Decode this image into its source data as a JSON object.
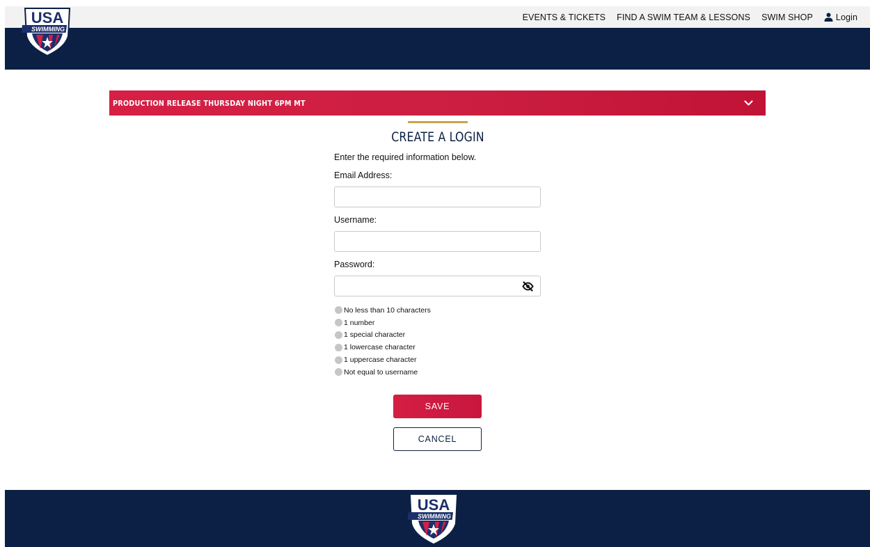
{
  "header": {
    "nav": [
      "EVENTS & TICKETS",
      "FIND A SWIM TEAM & LESSONS",
      "SWIM SHOP"
    ],
    "login_label": "Login",
    "logo": {
      "top": "USA",
      "bottom": "SWIMMING"
    }
  },
  "alert": {
    "text": "PRODUCTION RELEASE THURSDAY NIGHT 6PM MT"
  },
  "form": {
    "title": "CREATE A LOGIN",
    "subtitle": "Enter the required information below.",
    "email_label": "Email Address:",
    "email_value": "",
    "username_label": "Username:",
    "username_value": "",
    "password_label": "Password:",
    "password_value": "",
    "rules": [
      "No less than 10 characters",
      "1 number",
      "1 special character",
      "1 lowercase character",
      "1 uppercase character",
      "Not equal to username"
    ],
    "save_label": "SAVE",
    "cancel_label": "CANCEL"
  },
  "colors": {
    "navy": "#0b2044",
    "red": "#d61f44",
    "gold": "#c7a44b",
    "rule_dot": "#c6c6c6"
  },
  "icons": {
    "user": "user-icon",
    "chevron": "chevron-down-icon",
    "eye": "eye-slash-icon",
    "logo": "usa-swimming-logo"
  }
}
